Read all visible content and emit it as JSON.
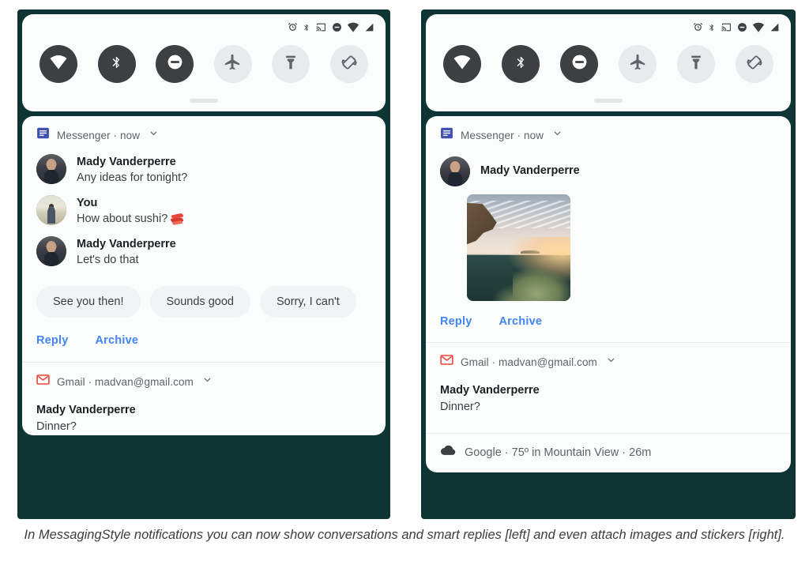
{
  "statusbar": {
    "icons": [
      "alarm-icon",
      "bluetooth-icon",
      "cast-icon",
      "do-not-disturb-icon",
      "wifi-icon",
      "cellular-signal-icon"
    ]
  },
  "quick_settings": {
    "toggles": [
      {
        "name": "wifi",
        "icon": "wifi-icon",
        "state": "on"
      },
      {
        "name": "bluetooth",
        "icon": "bluetooth-icon",
        "state": "on"
      },
      {
        "name": "do-not-disturb",
        "icon": "do-not-disturb-icon",
        "state": "on"
      },
      {
        "name": "airplane-mode",
        "icon": "airplane-icon",
        "state": "off"
      },
      {
        "name": "flashlight",
        "icon": "flashlight-icon",
        "state": "off"
      },
      {
        "name": "auto-rotate",
        "icon": "auto-rotate-icon",
        "state": "off"
      }
    ]
  },
  "left_panel": {
    "messenger": {
      "app_label": "Messenger · now",
      "app_icon": "messenger-icon",
      "expand_icon": "chevron-down-icon",
      "messages": [
        {
          "sender": "Mady Vanderperre",
          "text": "Any ideas for tonight?",
          "avatar": "avatar-mady"
        },
        {
          "sender": "You",
          "text": "How about sushi?",
          "sticker": "sushi-emoji",
          "avatar": "avatar-you"
        },
        {
          "sender": "Mady Vanderperre",
          "text": "Let's do that",
          "avatar": "avatar-mady"
        }
      ],
      "smart_replies": [
        "See you then!",
        "Sounds good",
        "Sorry, I can't"
      ],
      "actions": [
        "Reply",
        "Archive"
      ]
    },
    "gmail": {
      "app_label": "Gmail · madvan@gmail.com",
      "app_icon": "gmail-icon",
      "expand_icon": "chevron-down-icon",
      "title": "Mady Vanderperre",
      "subtitle": "Dinner?"
    }
  },
  "right_panel": {
    "messenger": {
      "app_label": "Messenger · now",
      "app_icon": "messenger-icon",
      "expand_icon": "chevron-down-icon",
      "sender": "Mady Vanderperre",
      "attachment": "sunset-landscape-photo",
      "actions": [
        "Reply",
        "Archive"
      ]
    },
    "gmail": {
      "app_label": "Gmail · madvan@gmail.com",
      "app_icon": "gmail-icon",
      "expand_icon": "chevron-down-icon",
      "title": "Mady Vanderperre",
      "subtitle": "Dinner?"
    },
    "google": {
      "app_icon": "cloud-icon",
      "text": "Google · 75º in Mountain View · 26m"
    }
  },
  "caption": "In MessagingStyle notifications you can now show conversations and smart replies [left] and even attach images and stickers [right].",
  "colors": {
    "accent_link": "#4285f4",
    "toggle_on": "#3c4043",
    "toggle_off": "#e8eaed",
    "phone_backdrop": "#0e3533",
    "card_bg": "#fbfcfc",
    "gmail_red": "#ea4335",
    "messenger_blue": "#3f51b5"
  }
}
